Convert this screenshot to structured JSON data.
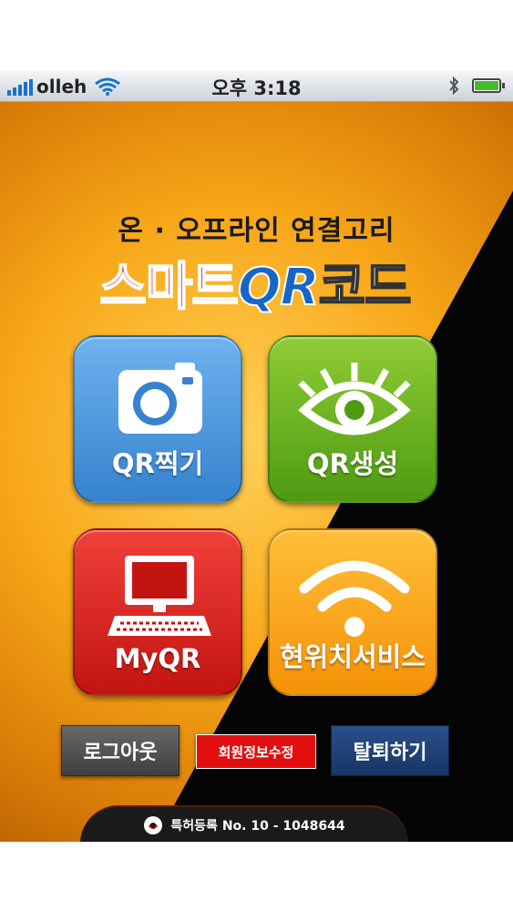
{
  "status_bar": {
    "carrier": "olleh",
    "time": "오후 3:18",
    "signal_icon": "signal-bars-icon",
    "wifi_icon": "wifi-icon",
    "bluetooth_icon": "bluetooth-icon",
    "battery_icon": "battery-icon",
    "battery_level": 1.0
  },
  "header": {
    "subtitle": "온 · 오프라인 연결고리",
    "title_part1": "스마트",
    "title_part2": "QR",
    "title_part3": "코드"
  },
  "tiles": [
    {
      "label": "QR찍기",
      "icon": "camera-icon",
      "color": "#3f8bd6"
    },
    {
      "label": "QR생성",
      "icon": "eye-icon",
      "color": "#5aa718"
    },
    {
      "label": "MyQR",
      "icon": "computer-icon",
      "color": "#d81c16"
    },
    {
      "label": "현위치서비스",
      "icon": "wifi-signal-icon",
      "color": "#f7a014"
    }
  ],
  "buttons": {
    "logout": "로그아웃",
    "edit_member": "회원정보수정",
    "withdraw": "탈퇴하기"
  },
  "footer": {
    "text": "특허등록 No. 10 - 1048644",
    "icon": "patent-logo-icon"
  },
  "colors": {
    "accent_red": "#e3261e",
    "accent_blue": "#1566c8",
    "background_orange": "#f8a718"
  }
}
